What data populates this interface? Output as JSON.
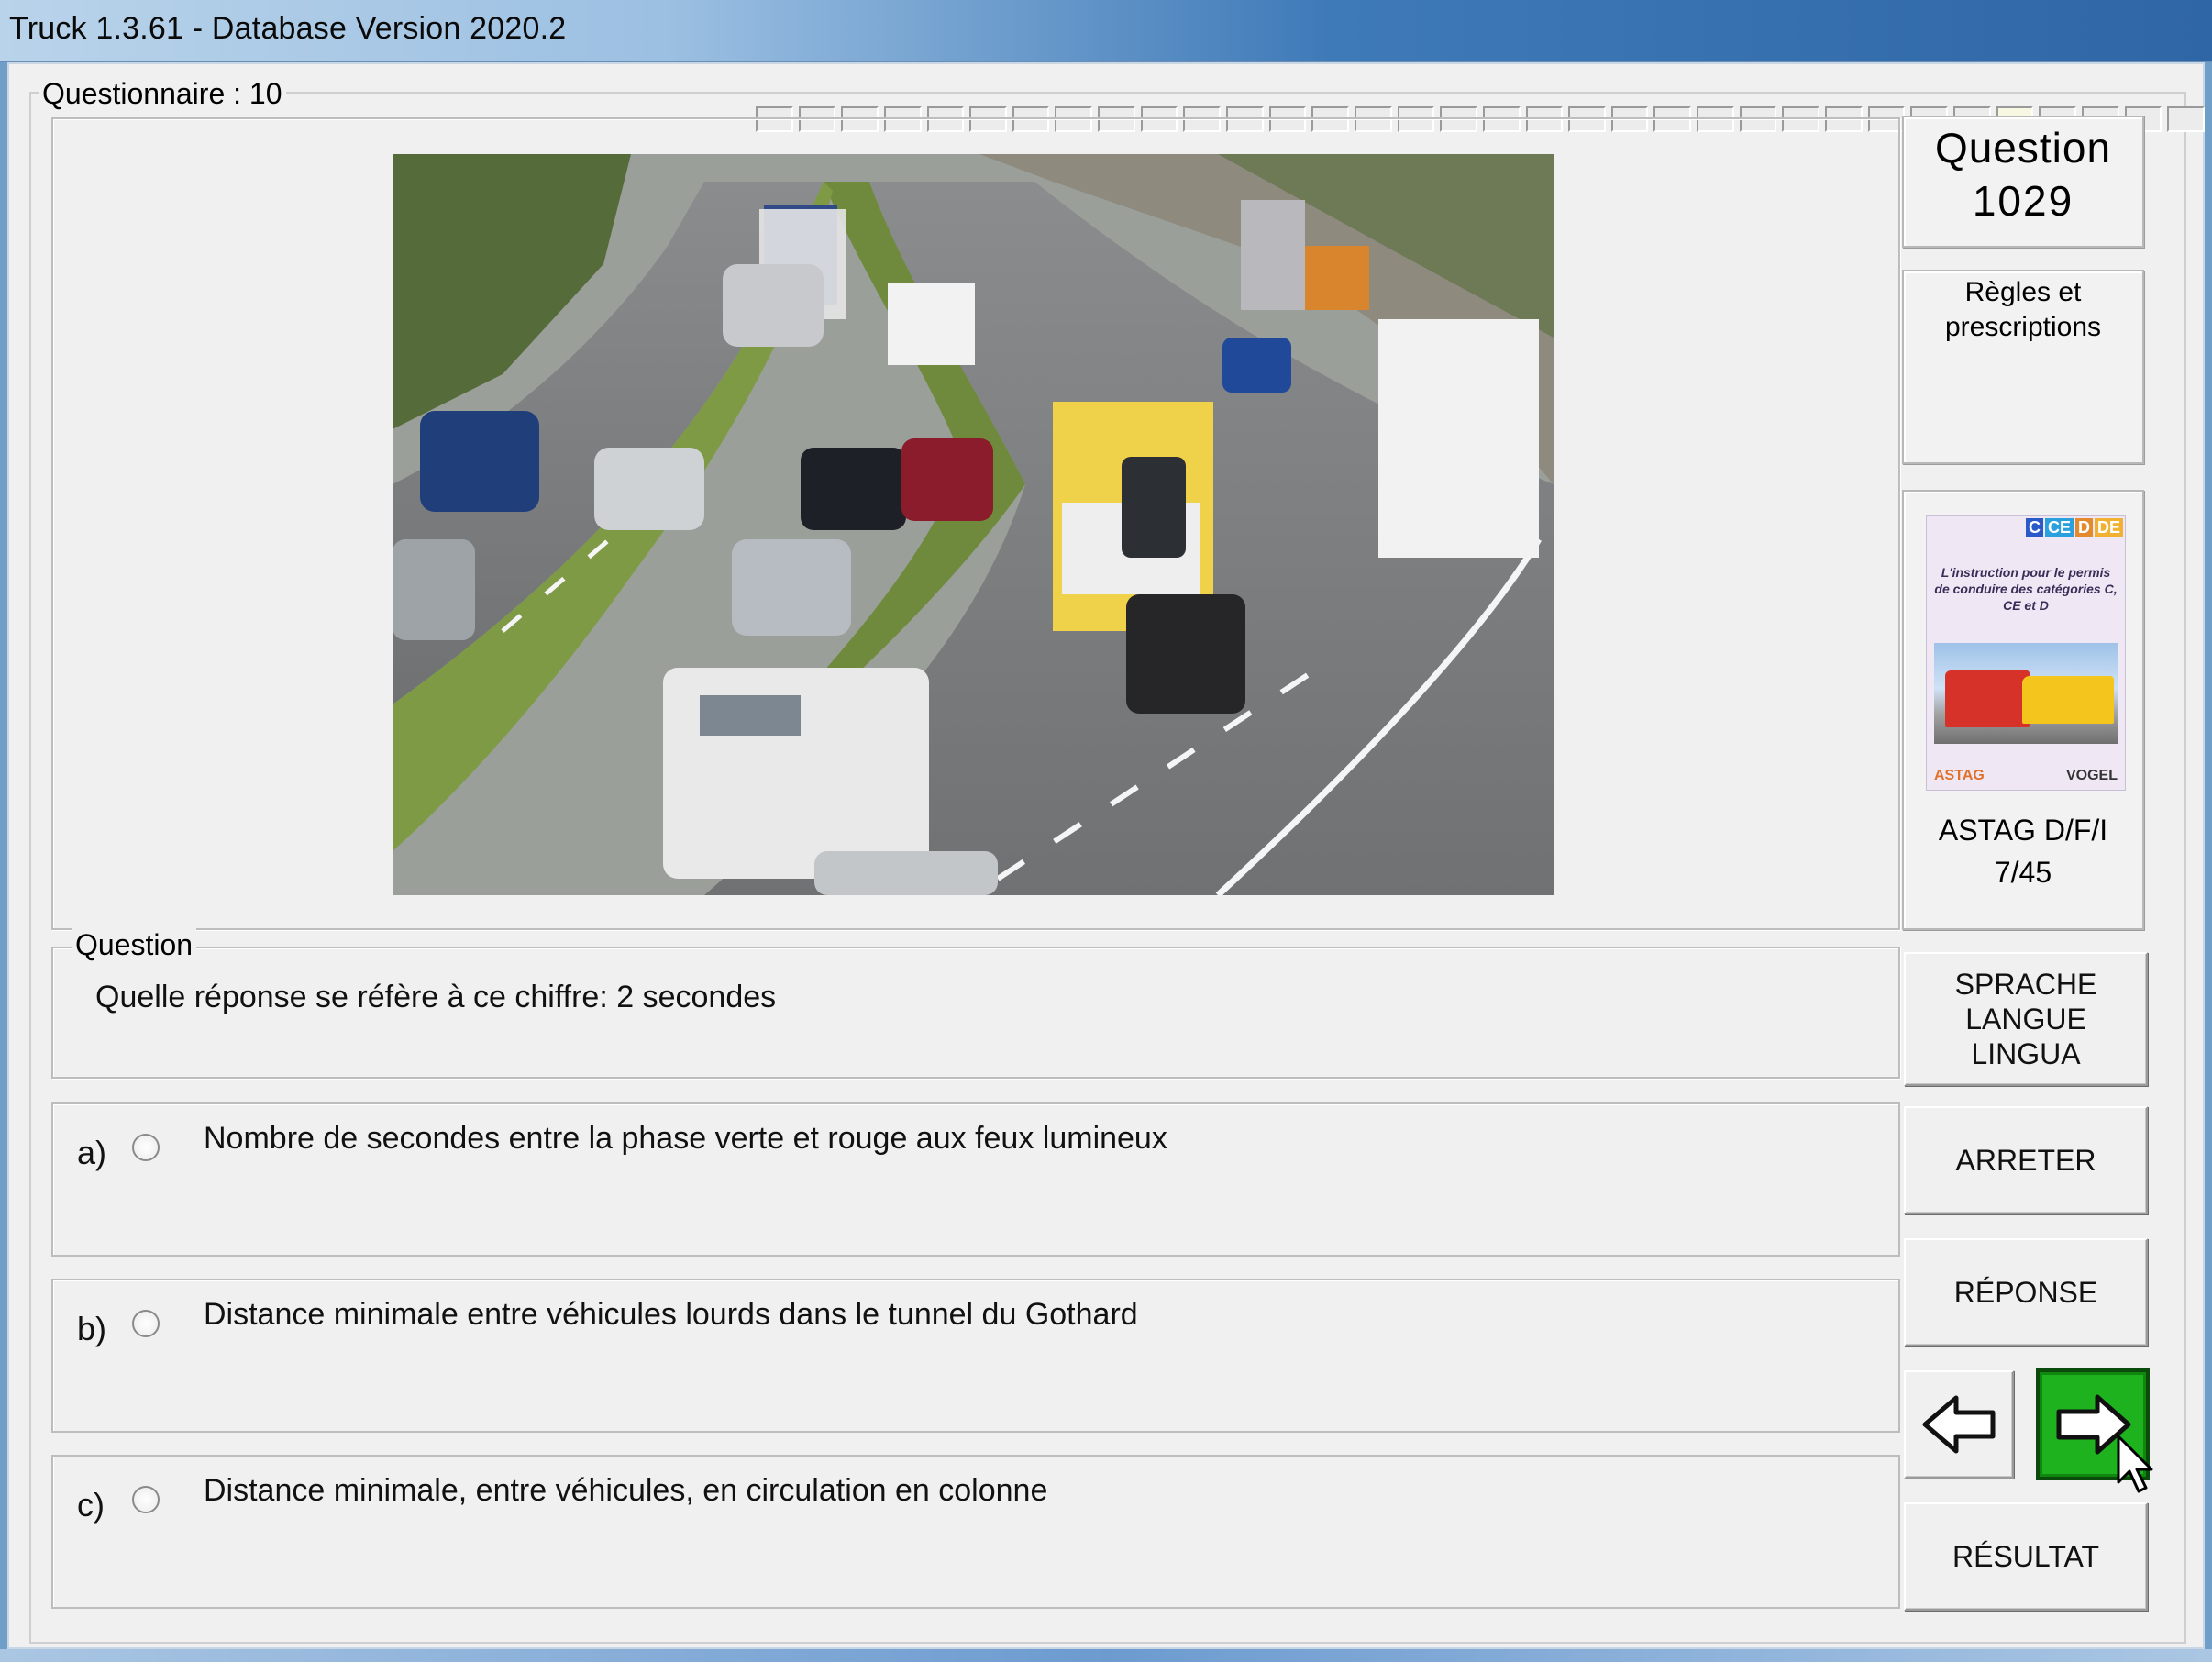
{
  "window": {
    "title": "Truck 1.3.61 - Database Version 2020.2"
  },
  "questionnaire": {
    "label": "Questionnaire : 10",
    "progress_cells": 34,
    "progress_done_index": 29
  },
  "question": {
    "group_label": "Question",
    "text": "Quelle réponse se réfère à ce chiffre: 2 secondes"
  },
  "answers": [
    {
      "letter": "a)",
      "text": "Nombre de secondes entre la phase verte et rouge aux feux lumineux"
    },
    {
      "letter": "b)",
      "text": "Distance minimale entre véhicules lourds dans le tunnel du Gothard"
    },
    {
      "letter": "c)",
      "text": "Distance minimale, entre véhicules, en circulation en colonne"
    }
  ],
  "sidebar": {
    "question_label": "Question",
    "question_number": "1029",
    "category_line1": "Règles et",
    "category_line2": "prescriptions",
    "book": {
      "categories": [
        "C",
        "CE",
        "D",
        "DE"
      ],
      "cover_title": "L'instruction pour le permis de conduire des catégories C, CE et D",
      "logo_left": "ASTAG",
      "logo_right": "VOGEL",
      "label_line1": "ASTAG D/F/I",
      "label_line2": "7/45"
    },
    "buttons": {
      "lang_line1": "SPRACHE",
      "lang_line2": "LANGUE",
      "lang_line3": "LINGUA",
      "stop": "ARRETER",
      "answer": "RÉPONSE",
      "result": "RÉSULTAT"
    }
  },
  "colors": {
    "next_button": "#1fb21f",
    "cat_c": "#2a59c9",
    "cat_ce": "#2aa0de",
    "cat_d": "#e48a2e",
    "cat_de": "#f1b233"
  }
}
